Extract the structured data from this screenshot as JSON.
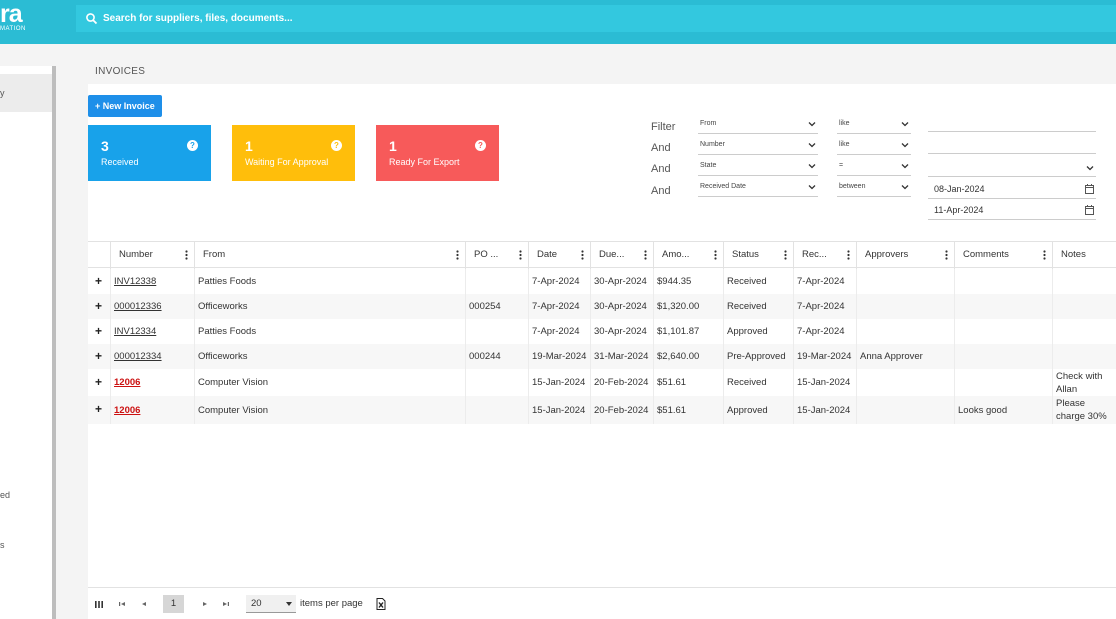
{
  "brand": {
    "logo_text": "ra",
    "tagline": "MATION"
  },
  "search": {
    "placeholder": "Search for suppliers, files, documents..."
  },
  "sidebar": {
    "items": [
      {
        "label": "y"
      },
      {
        "label": "ed"
      },
      {
        "label": "s"
      }
    ]
  },
  "page": {
    "title": "INVOICES",
    "new_invoice_label": "+ New Invoice"
  },
  "cards": [
    {
      "count": "3",
      "label": "Received",
      "color": "#18a2ea"
    },
    {
      "count": "1",
      "label": "Waiting For Approval",
      "color": "#ffbe0b"
    },
    {
      "count": "1",
      "label": "Ready For Export",
      "color": "#f75a5a"
    }
  ],
  "filters": {
    "rows": [
      {
        "label": "Filter",
        "field": "From",
        "operator": "like"
      },
      {
        "label": "And",
        "field": "Number",
        "operator": "like"
      },
      {
        "label": "And",
        "field": "State",
        "operator": "="
      },
      {
        "label": "And",
        "field": "Received Date",
        "operator": "between"
      }
    ],
    "date_from": "08-Jan-2024",
    "date_to": "11-Apr-2024"
  },
  "table": {
    "headers": [
      "Number",
      "From",
      "PO ...",
      "Date",
      "Due...",
      "Amo...",
      "Status",
      "Rec...",
      "Approvers",
      "Comments",
      "Notes"
    ],
    "rows": [
      {
        "number": "INV12338",
        "from": "Patties Foods",
        "po": "",
        "date": "7-Apr-2024",
        "due": "30-Apr-2024",
        "amount": "$944.35",
        "status": "Received",
        "received": "7-Apr-2024",
        "approvers": "",
        "comments": "",
        "notes": ""
      },
      {
        "number": "000012336",
        "from": "Officeworks",
        "po": "000254",
        "date": "7-Apr-2024",
        "due": "30-Apr-2024",
        "amount": "$1,320.00",
        "status": "Received",
        "received": "7-Apr-2024",
        "approvers": "",
        "comments": "",
        "notes": ""
      },
      {
        "number": "INV12334",
        "from": "Patties Foods",
        "po": "",
        "date": "7-Apr-2024",
        "due": "30-Apr-2024",
        "amount": "$1,101.87",
        "status": "Approved",
        "received": "7-Apr-2024",
        "approvers": "",
        "comments": "",
        "notes": ""
      },
      {
        "number": "000012334",
        "from": "Officeworks",
        "po": "000244",
        "date": "19-Mar-2024",
        "due": "31-Mar-2024",
        "amount": "$2,640.00",
        "status": "Pre-Approved",
        "received": "19-Mar-2024",
        "approvers": "Anna Approver",
        "comments": "",
        "notes": ""
      },
      {
        "number": "12006",
        "from": "Computer Vision",
        "po": "",
        "date": "15-Jan-2024",
        "due": "20-Feb-2024",
        "amount": "$51.61",
        "status": "Received",
        "received": "15-Jan-2024",
        "approvers": "",
        "comments": "",
        "notes": "Check with Allan"
      },
      {
        "number": "12006",
        "from": "Computer Vision",
        "po": "",
        "date": "15-Jan-2024",
        "due": "20-Feb-2024",
        "amount": "$51.61",
        "status": "Approved",
        "received": "15-Jan-2024",
        "approvers": "",
        "comments": "Looks good",
        "notes": "Please charge 30%"
      }
    ]
  },
  "pager": {
    "current_page": "1",
    "page_size": "20",
    "items_per_page_label": "items per page"
  }
}
